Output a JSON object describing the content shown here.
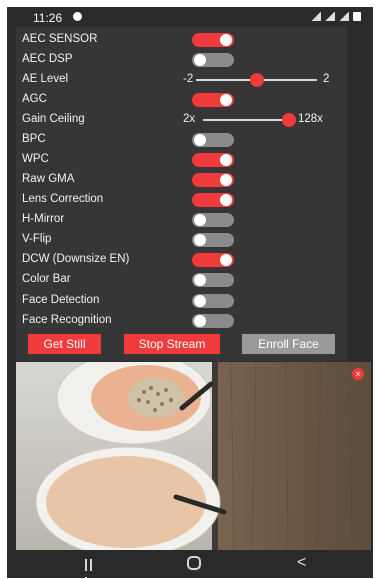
{
  "status_bar": {
    "time": "11:26",
    "status_icon": "notification-icon",
    "right_icons": [
      "wifi-icon",
      "signal-icon",
      "signal-icon",
      "battery-icon"
    ]
  },
  "settings": {
    "aec_sensor": {
      "label": "AEC SENSOR",
      "on": true
    },
    "aec_dsp": {
      "label": "AEC DSP",
      "on": false
    },
    "ae_level": {
      "label": "AE Level",
      "min": "-2",
      "max": "2",
      "value": 0
    },
    "agc": {
      "label": "AGC",
      "on": true
    },
    "gain_ceiling": {
      "label": "Gain Ceiling",
      "min": "2x",
      "max": "128x",
      "value": 128
    },
    "bpc": {
      "label": "BPC",
      "on": false
    },
    "wpc": {
      "label": "WPC",
      "on": true
    },
    "raw_gma": {
      "label": "Raw GMA",
      "on": true
    },
    "lens_correction": {
      "label": "Lens Correction",
      "on": true
    },
    "h_mirror": {
      "label": "H-Mirror",
      "on": false
    },
    "v_flip": {
      "label": "V-Flip",
      "on": false
    },
    "dcw": {
      "label": "DCW (Downsize EN)",
      "on": true
    },
    "color_bar": {
      "label": "Color Bar",
      "on": false
    },
    "face_detection": {
      "label": "Face Detection",
      "on": false
    },
    "face_recognition": {
      "label": "Face Recognition",
      "on": false
    }
  },
  "buttons": {
    "get_still": "Get Still",
    "stop_stream": "Stop Stream",
    "enroll_face": "Enroll Face"
  },
  "preview": {
    "close_glyph": "×",
    "colors": {
      "toggle_on": "#ef3b3b",
      "toggle_off": "#8b8b8b",
      "panel": "#363636"
    }
  },
  "nav_bar": {
    "back_glyph": "<",
    "icons": [
      "recent-apps-icon",
      "home-icon",
      "back-icon"
    ]
  }
}
